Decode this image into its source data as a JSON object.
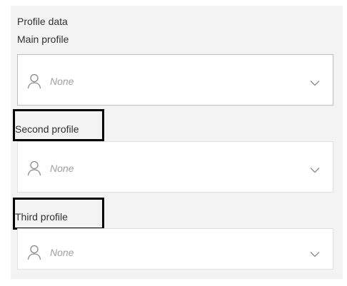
{
  "section": {
    "title": "Profile data"
  },
  "fields": [
    {
      "label": "Main profile",
      "value": "None",
      "icon": "person-icon"
    },
    {
      "label": "Second profile",
      "value": "None",
      "icon": "person-icon"
    },
    {
      "label": "Third profile",
      "value": "None",
      "icon": "person-icon"
    }
  ],
  "colors": {
    "panel_background": "#f3f3f3",
    "text": "#323130",
    "placeholder": "#a19f9d",
    "highlight_border": "#000000"
  }
}
